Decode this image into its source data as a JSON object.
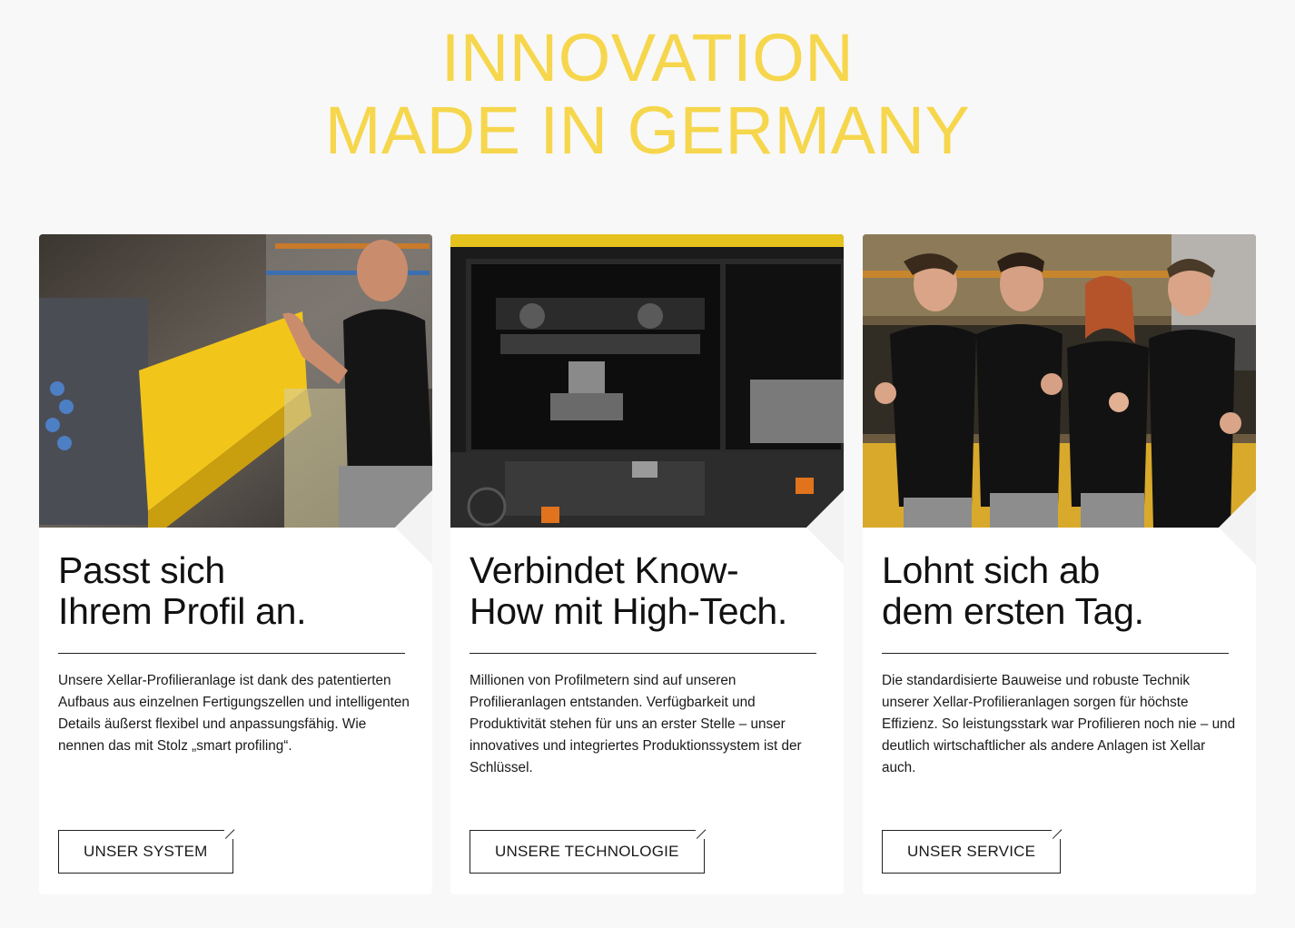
{
  "headline": {
    "line1": "INNOVATION",
    "line2": "MADE IN GERMANY",
    "color": "#f6d64c"
  },
  "cards": [
    {
      "photo": "worker-with-yellow-machine-photo",
      "title": "Passt sich\nIhrem Profil an.",
      "text": "Unsere Xellar-Profilieranlage ist dank des patentierten Aufbaus aus einzelnen Fertigungszellen und intelligenten Details äußerst flexibel und anpassungsfähig. Wie nennen das mit Stolz „smart profiling“.",
      "button": "UNSER SYSTEM"
    },
    {
      "photo": "roll-forming-machine-closeup-photo",
      "title": "Verbindet Know-\nHow mit High-Tech.",
      "text": "Millionen von Profilmetern sind auf unseren Profilieranlagen entstanden. Verfügbarkeit und Produktivität stehen für uns an erster Stelle – unser innovatives und integriertes Produktionssystem ist der Schlüssel.",
      "button": "UNSERE TECHNOLOGIE"
    },
    {
      "photo": "team-thumbs-up-photo",
      "title": "Lohnt sich ab\ndem ersten Tag.",
      "text": "Die standardisierte Bauweise und robuste Technik unserer Xellar-Profilieranlagen sorgen für höchste Effizienz. So leistungsstark war Profilieren noch nie –  und deutlich wirtschaftlicher als andere Anlagen ist Xellar auch.",
      "button": "UNSER SERVICE"
    }
  ]
}
